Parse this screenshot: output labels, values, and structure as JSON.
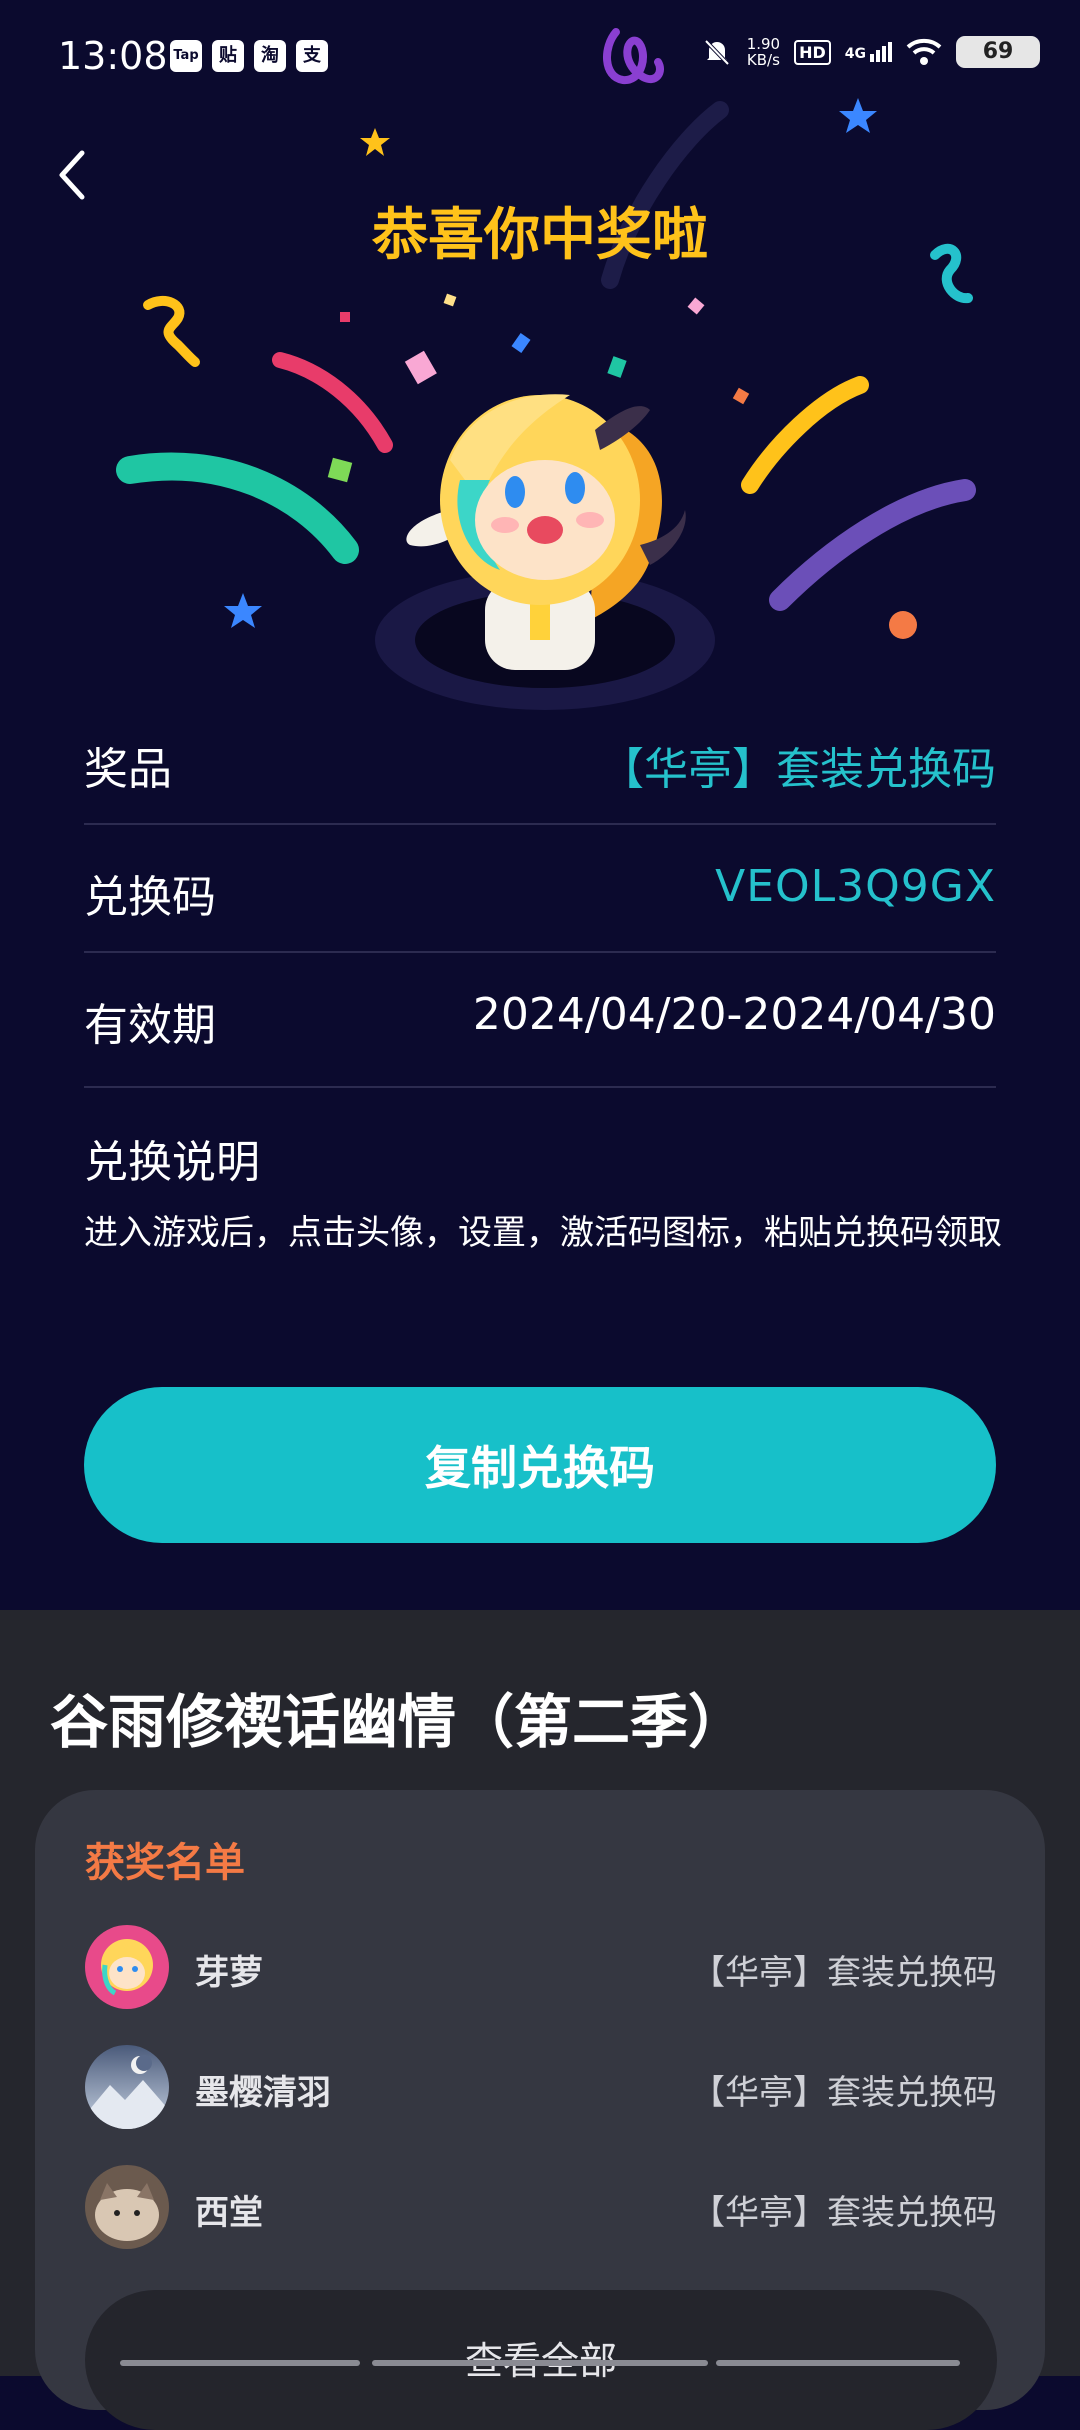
{
  "status_bar": {
    "time": "13:08",
    "apps": [
      "Tap",
      "贴",
      "淘",
      "支"
    ],
    "speed_value": "1.90",
    "speed_unit": "KB/s",
    "hd": "HD",
    "network": "4G",
    "battery": "69"
  },
  "header": {
    "title": "恭喜你中奖啦"
  },
  "prize_info": {
    "prize_label": "奖品",
    "prize_value": "【华亭】套装兑换码",
    "code_label": "兑换码",
    "code_value": "VEOL3Q9GX",
    "valid_label": "有效期",
    "valid_value": "2024/04/20-2024/04/30",
    "instructions_title": "兑换说明",
    "instructions_text": "进入游戏后，点击头像，设置，激活码图标，粘贴兑换码领取"
  },
  "copy_button": {
    "label": "复制兑换码"
  },
  "event": {
    "title": "谷雨修禊话幽情（第二季）",
    "winners_heading": "获奖名单",
    "winners": [
      {
        "name": "芽萝",
        "prize": "【华亭】套装兑换码"
      },
      {
        "name": "墨樱清羽",
        "prize": "【华亭】套装兑换码"
      },
      {
        "name": "西堂",
        "prize": "【华亭】套装兑换码"
      }
    ],
    "view_all_label": "查看全部"
  },
  "colors": {
    "background": "#0b0a2e",
    "accent": "#17c0c9",
    "title_gold": "#ffc21a",
    "winners_orange": "#f47a45",
    "bottom_panel": "#25262d"
  }
}
